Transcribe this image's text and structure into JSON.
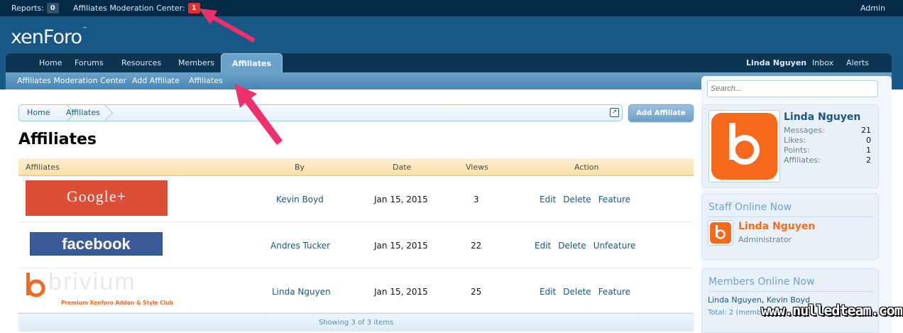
{
  "moderator_bar": {
    "reports_label": "Reports:",
    "reports_count": "0",
    "moderation_label": "Affiliates Moderation Center:",
    "moderation_count": "1",
    "admin_label": "Admin"
  },
  "header": {
    "logo_text": "xenForo",
    "logo_mark": "™"
  },
  "nav": {
    "tabs": [
      "Home",
      "Forums",
      "Resources",
      "Members",
      "Affiliates"
    ],
    "selected_tab": "Affiliates",
    "user_name": "Linda Nguyen",
    "inbox_label": "Inbox",
    "alerts_label": "Alerts",
    "sub_links": [
      "Affiliates Moderation Center",
      "Add Affiliate",
      "Affiliates"
    ]
  },
  "breadcrumb": {
    "items": [
      "Home",
      "Affiliates"
    ]
  },
  "add_affiliate_button": "Add Affiliate",
  "page_title": "Affiliates",
  "table": {
    "headers": [
      "Affiliates",
      "By",
      "Date",
      "Views",
      "Action"
    ],
    "rows": [
      {
        "logo": "Google+",
        "by": "Kevin Boyd",
        "date": "Jan 15, 2015",
        "views": "3",
        "actions": [
          "Edit",
          "Delete",
          "Feature"
        ]
      },
      {
        "logo": "facebook",
        "by": "Andres Tucker",
        "date": "Jan 15, 2015",
        "views": "22",
        "actions": [
          "Edit",
          "Delete",
          "Unfeature"
        ]
      },
      {
        "logo": "brivium",
        "logo_tagline": "Premium Xenforo Addon & Style Club",
        "by": "Linda Nguyen",
        "date": "Jan 15, 2015",
        "views": "25",
        "actions": [
          "Edit",
          "Delete",
          "Feature"
        ]
      }
    ],
    "footer": "Showing 3 of 3 items"
  },
  "sidebar": {
    "search_placeholder": "Search...",
    "visitor": {
      "name": "Linda Nguyen",
      "stats": [
        {
          "label": "Messages:",
          "value": "21"
        },
        {
          "label": "Likes:",
          "value": "0"
        },
        {
          "label": "Points:",
          "value": "1"
        },
        {
          "label": "Affiliates:",
          "value": "2"
        }
      ]
    },
    "staff_online": {
      "title": "Staff Online Now",
      "name": "Linda Nguyen",
      "role": "Administrator"
    },
    "members_online": {
      "title": "Members Online Now",
      "members": [
        "Linda Nguyen",
        "Kevin Boyd"
      ],
      "separator": ",",
      "total": "Total: 2 (member"
    }
  },
  "watermark": "www.nulledteam.com",
  "colors": {
    "moderator_bar": "#032a46",
    "header": "#185886",
    "link": "#185886",
    "alert_count": "#e03030",
    "brivium_orange": "#f7691d",
    "google_red": "#dc4e35",
    "facebook_blue": "#3b5a9a",
    "annotation_arrow": "#f0306a"
  }
}
